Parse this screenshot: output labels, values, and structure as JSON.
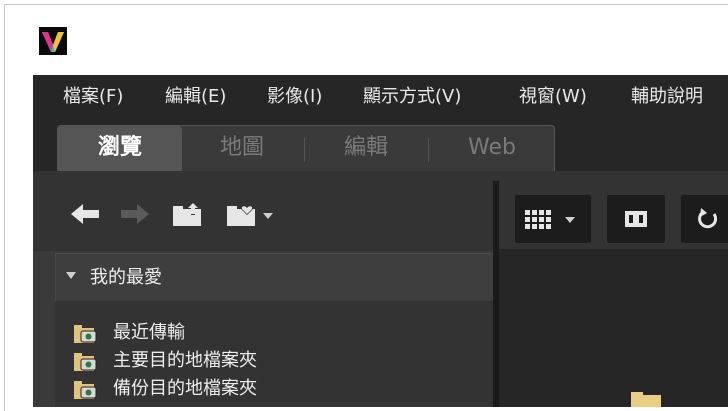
{
  "window": {
    "logo": "v-app-logo"
  },
  "menu": {
    "items": [
      {
        "label": "檔案(F)"
      },
      {
        "label": "編輯(E)"
      },
      {
        "label": "影像(I)"
      },
      {
        "label": "顯示方式(V)"
      },
      {
        "label": "視窗(W)"
      },
      {
        "label": "輔助說明"
      }
    ]
  },
  "tabs": {
    "items": [
      {
        "label": "瀏覽",
        "active": true
      },
      {
        "label": "地圖",
        "active": false
      },
      {
        "label": "編輯",
        "active": false
      },
      {
        "label": "Web",
        "active": false
      }
    ]
  },
  "nav_toolbar": {
    "icons": [
      "back-arrow-icon",
      "forward-arrow-icon",
      "up-folder-icon",
      "favorite-folder-icon"
    ]
  },
  "favorites": {
    "header": "我的最愛",
    "items": [
      {
        "label": "最近傳輸",
        "icon": "camera-folder-icon"
      },
      {
        "label": "主要目的地檔案夾",
        "icon": "camera-folder-icon"
      },
      {
        "label": "備份目的地檔案夾",
        "icon": "camera-folder-icon"
      }
    ]
  },
  "right_toolbar": {
    "icons": [
      "grid-view-icon",
      "fit-frame-icon",
      "rotate-icon"
    ]
  },
  "colors": {
    "menubar_bg": "#262626",
    "panel_bg": "#333333",
    "active_tab_bg": "#555555",
    "text": "#e8e8e8",
    "inactive_tab_text": "#7a7a7a"
  }
}
